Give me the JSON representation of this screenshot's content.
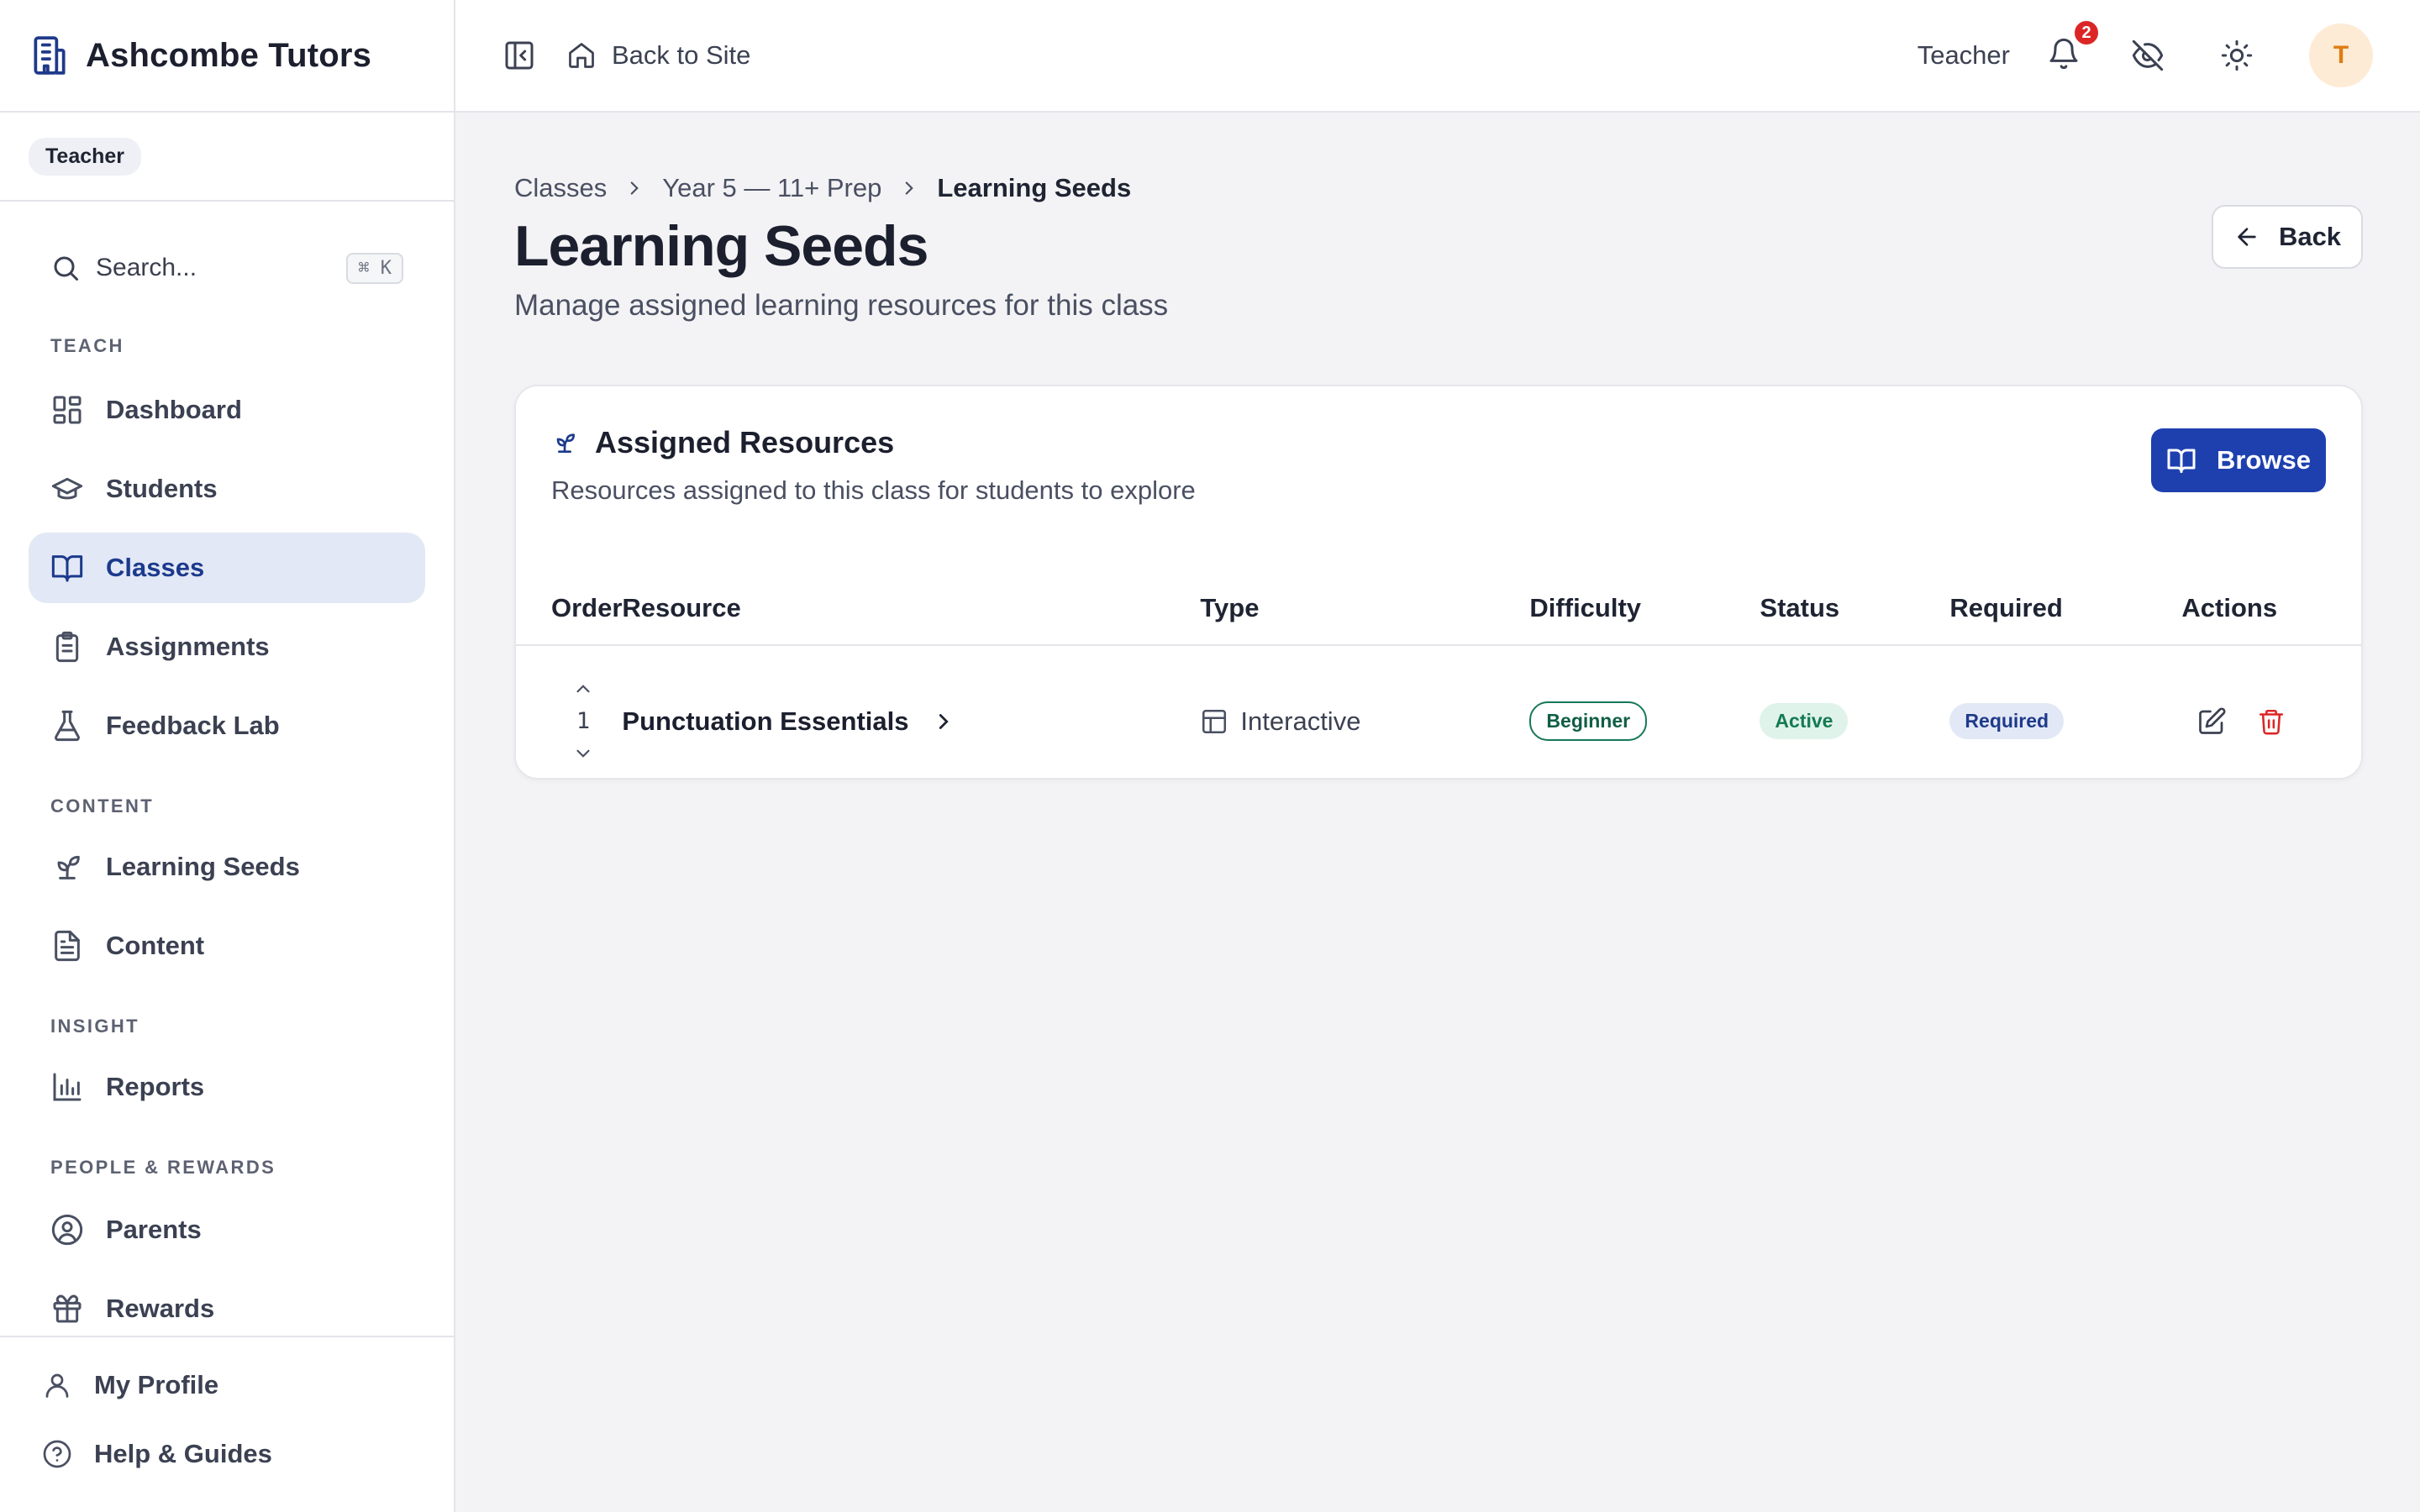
{
  "brand": {
    "name": "Ashcombe Tutors"
  },
  "sidebar": {
    "role_chip": "Teacher",
    "search": {
      "placeholder": "Search...",
      "shortcut": "⌘ K"
    },
    "sections": [
      {
        "label": "TEACH"
      },
      {
        "label": "CONTENT"
      },
      {
        "label": "INSIGHT"
      },
      {
        "label": "PEOPLE & REWARDS"
      }
    ],
    "items": {
      "dashboard": "Dashboard",
      "students": "Students",
      "classes": "Classes",
      "assignments": "Assignments",
      "feedback_lab": "Feedback Lab",
      "learning_seeds": "Learning Seeds",
      "content": "Content",
      "reports": "Reports",
      "parents": "Parents",
      "rewards": "Rewards"
    },
    "active_item": "Classes",
    "footer": {
      "profile": "My Profile",
      "help": "Help & Guides"
    }
  },
  "topbar": {
    "back_to_site": "Back to Site",
    "role": "Teacher",
    "notification_count": "2",
    "avatar_initial": "T"
  },
  "breadcrumb": [
    "Classes",
    "Year 5 — 11+ Prep",
    "Learning Seeds"
  ],
  "page": {
    "title": "Learning Seeds",
    "subtitle": "Manage assigned learning resources for this class",
    "back_label": "Back"
  },
  "card": {
    "title": "Assigned Resources",
    "subtitle": "Resources assigned to this class for students to explore",
    "browse_label": "Browse",
    "columns": [
      "Order",
      "Resource",
      "Type",
      "Difficulty",
      "Status",
      "Required",
      "Actions"
    ],
    "rows": [
      {
        "order": "1",
        "resource": "Punctuation Essentials",
        "type": "Interactive",
        "difficulty": "Beginner",
        "status": "Active",
        "required": "Required"
      }
    ]
  },
  "colors": {
    "accent": "#1e40af",
    "active_nav_bg": "#e3e8f6",
    "danger": "#dc2626",
    "success": "#147a52"
  }
}
